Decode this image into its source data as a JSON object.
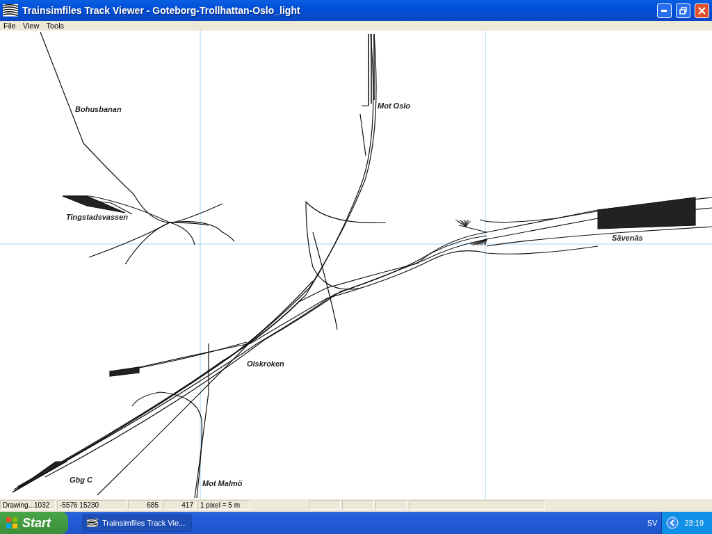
{
  "window": {
    "title": "Trainsimfiles Track Viewer - Goteborg-Trollhattan-Oslo_light"
  },
  "menu": [
    "File",
    "View",
    "Tools"
  ],
  "map_labels": [
    "Bohusbanan",
    "Mot Oslo",
    "Tingstadsvassen",
    "Sävenäs",
    "Olskroken",
    "Gbg C",
    "Mot Malmö"
  ],
  "status_bar": [
    "Drawing...1032",
    "-5576 15230",
    "685",
    "417",
    "1 pixel = 5 m"
  ],
  "taskbar": {
    "start": "Start",
    "task": "Trainsimfiles Track Vie...",
    "language": "SV",
    "clock": "23:19"
  }
}
